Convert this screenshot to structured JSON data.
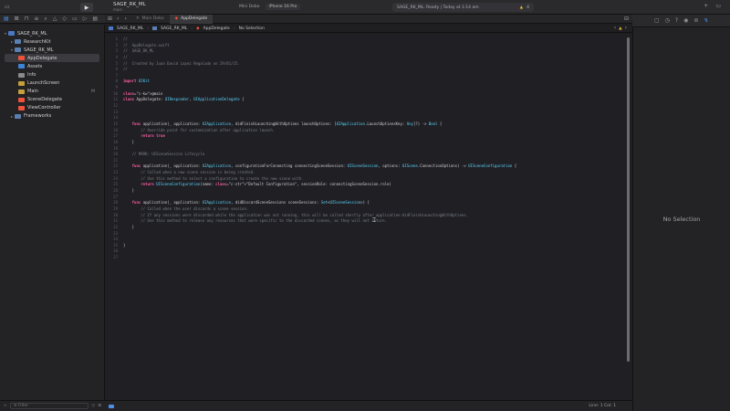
{
  "titlebar": {
    "scheme_name": "SAGE_RK_ML",
    "scheme_branch": "main",
    "destination_tab": "Mini Dobo",
    "destination_device": "iPhone 16 Pro",
    "status": "SAGE_RK_ML: Ready | Today at 1:14 am",
    "warnings": "4"
  },
  "tabs": [
    {
      "label": "Main Debo"
    },
    {
      "label": "AppDelegate"
    }
  ],
  "jumpbar": {
    "project": "SAGE_RK_ML",
    "folder": "SAGE_RK_ML",
    "file": "AppDelegate",
    "selection": "No Selection"
  },
  "navigator": {
    "items": [
      {
        "label": "SAGE_RK_ML",
        "icon": "project-icon"
      },
      {
        "label": "ResearchKit",
        "icon": "folder-icon"
      },
      {
        "label": "SAGE_RK_ML",
        "icon": "folder-icon"
      },
      {
        "label": "AppDelegate",
        "icon": "swift-file-icon"
      },
      {
        "label": "Assets",
        "icon": "asset-catalog-icon"
      },
      {
        "label": "Info",
        "icon": "plist-icon"
      },
      {
        "label": "LaunchScreen",
        "icon": "storyboard-icon"
      },
      {
        "label": "Main",
        "icon": "storyboard-icon",
        "badge": "M"
      },
      {
        "label": "SceneDelegate",
        "icon": "swift-file-icon"
      },
      {
        "label": "ViewController",
        "icon": "swift-file-icon"
      },
      {
        "label": "Frameworks",
        "icon": "folder-icon"
      }
    ],
    "filter_placeholder": "Filter"
  },
  "editor": {
    "line_numbers": [
      "1",
      "2",
      "3",
      "4",
      "5",
      "6",
      "7",
      "8",
      "9",
      "10",
      "11",
      "12",
      "13",
      "14",
      "15",
      "16",
      "17",
      "18",
      "19",
      "20",
      "21",
      "22",
      "23",
      "24",
      "25",
      "26",
      "27",
      "28",
      "29",
      "30",
      "31",
      "32",
      "33",
      "34",
      "35",
      "36",
      "37"
    ],
    "lines": [
      "//",
      "//  AppDelegate.swift",
      "//  SAGE_RK_ML",
      "//",
      "//  Created by Juan David Lopez Regalado on 29/01/25.",
      "//",
      "",
      "import UIKit",
      "",
      "@main",
      "class AppDelegate: UIResponder, UIApplicationDelegate {",
      "",
      "",
      "",
      "    func application(_ application: UIApplication, didFinishLaunchingWithOptions launchOptions: [UIApplication.LaunchOptionsKey: Any]?) -> Bool {",
      "        // Override point for customization after application launch.",
      "        return true",
      "    }",
      "",
      "    // MARK: UISceneSession Lifecycle",
      "",
      "    func application(_ application: UIApplication, configurationForConnecting connectingSceneSession: UISceneSession, options: UIScene.ConnectionOptions) -> UISceneConfiguration {",
      "        // Called when a new scene session is being created.",
      "        // Use this method to select a configuration to create the new scene with.",
      "        return UISceneConfiguration(name: \"Default Configuration\", sessionRole: connectingSceneSession.role)",
      "    }",
      "",
      "    func application(_ application: UIApplication, didDiscardSceneSessions sceneSessions: Set<UISceneSession>) {",
      "        // Called when the user discards a scene session.",
      "        // If any sessions were discarded while the application was not running, this will be called shortly after application:didFinishLaunchingWithOptions.",
      "        // Use this method to release any resources that were specific to the discarded scenes, as they will not return.",
      "    }",
      "",
      "",
      "}",
      "",
      ""
    ]
  },
  "debugbar": {
    "position": "Line: 1  Col: 1"
  },
  "inspector": {
    "empty_text": "No Selection"
  },
  "colors": {
    "accent": "#4a90e6",
    "swift": "#f05138",
    "warning": "#e8b73a",
    "keyword": "#fc5fa3",
    "type": "#5dd8ff",
    "comment": "#7c8086",
    "string": "#fc6a5d"
  }
}
